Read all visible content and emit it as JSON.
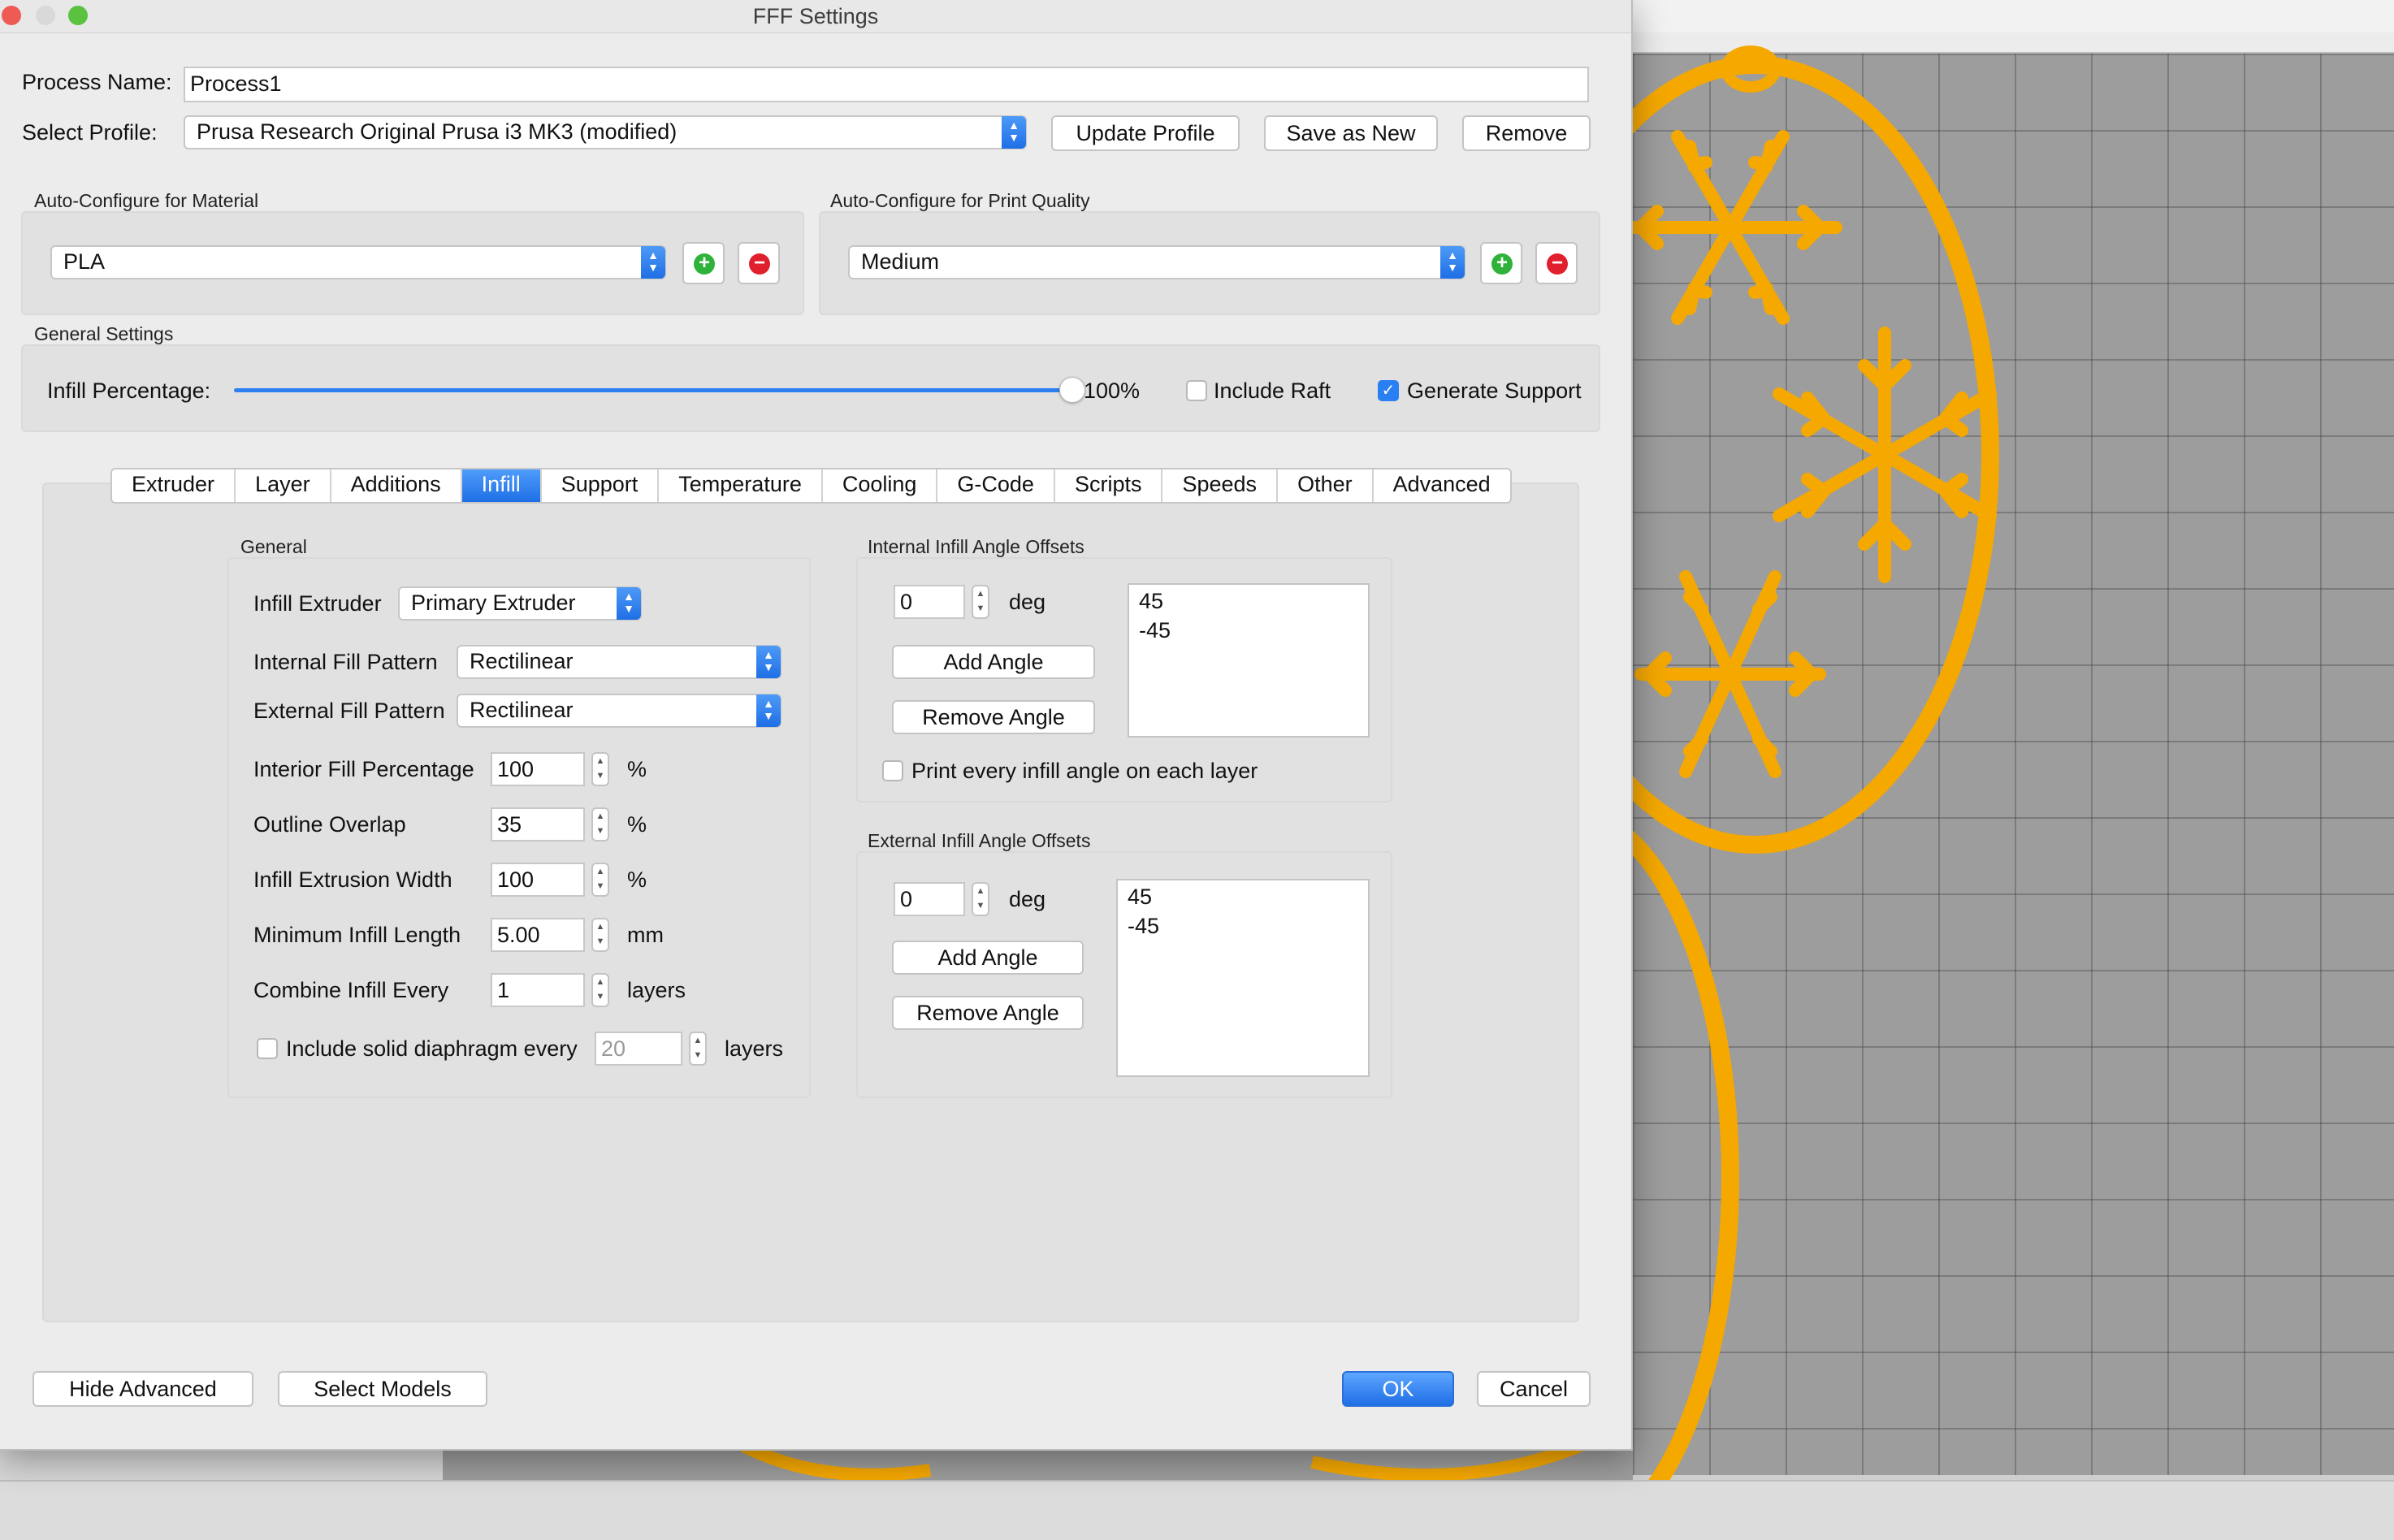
{
  "window": {
    "title": "FFF Settings"
  },
  "process": {
    "name_label": "Process Name:",
    "name_value": "Process1"
  },
  "profile": {
    "label": "Select Profile:",
    "selected": "Prusa Research Original Prusa i3 MK3 (modified)",
    "update_label": "Update Profile",
    "save_as_new_label": "Save as New",
    "remove_label": "Remove"
  },
  "material": {
    "heading": "Auto-Configure for Material",
    "selected": "PLA"
  },
  "quality": {
    "heading": "Auto-Configure for Print Quality",
    "selected": "Medium"
  },
  "general_settings": {
    "heading": "General Settings",
    "infill_label": "Infill Percentage:",
    "infill_value_text": "100%",
    "infill_fraction": 1.0,
    "include_raft_label": "Include Raft",
    "include_raft_checked": false,
    "generate_support_label": "Generate Support",
    "generate_support_checked": true
  },
  "tabs": [
    {
      "label": "Extruder",
      "active": false
    },
    {
      "label": "Layer",
      "active": false
    },
    {
      "label": "Additions",
      "active": false
    },
    {
      "label": "Infill",
      "active": true
    },
    {
      "label": "Support",
      "active": false
    },
    {
      "label": "Temperature",
      "active": false
    },
    {
      "label": "Cooling",
      "active": false
    },
    {
      "label": "G-Code",
      "active": false
    },
    {
      "label": "Scripts",
      "active": false
    },
    {
      "label": "Speeds",
      "active": false
    },
    {
      "label": "Other",
      "active": false
    },
    {
      "label": "Advanced",
      "active": false
    }
  ],
  "infill_general": {
    "heading": "General",
    "extruder_label": "Infill Extruder",
    "extruder_value": "Primary Extruder",
    "internal_pattern_label": "Internal Fill Pattern",
    "internal_pattern_value": "Rectilinear",
    "external_pattern_label": "External Fill Pattern",
    "external_pattern_value": "Rectilinear",
    "interior_pct_label": "Interior Fill Percentage",
    "interior_pct_value": "100",
    "interior_pct_unit": "%",
    "outline_overlap_label": "Outline Overlap",
    "outline_overlap_value": "35",
    "outline_overlap_unit": "%",
    "extrusion_width_label": "Infill Extrusion Width",
    "extrusion_width_value": "100",
    "extrusion_width_unit": "%",
    "min_length_label": "Minimum Infill Length",
    "min_length_value": "5.00",
    "min_length_unit": "mm",
    "combine_label": "Combine Infill Every",
    "combine_value": "1",
    "combine_unit": "layers",
    "diaphragm_label": "Include solid diaphragm every",
    "diaphragm_value": "20",
    "diaphragm_unit": "layers",
    "diaphragm_checked": false
  },
  "internal_offsets": {
    "heading": "Internal Infill Angle Offsets",
    "angle_value": "0",
    "unit": "deg",
    "add_label": "Add Angle",
    "remove_label": "Remove Angle",
    "angles": [
      "45",
      "-45"
    ],
    "every_layer_label": "Print every infill angle on each layer",
    "every_layer_checked": false
  },
  "external_offsets": {
    "heading": "External Infill Angle Offsets",
    "angle_value": "0",
    "unit": "deg",
    "add_label": "Add Angle",
    "remove_label": "Remove Angle",
    "angles": [
      "45",
      "-45"
    ]
  },
  "footer": {
    "hide_advanced_label": "Hide Advanced",
    "select_models_label": "Select Models",
    "ok_label": "OK",
    "cancel_label": "Cancel"
  },
  "colors": {
    "accent": "#1f6fe6",
    "model_orange": "#f5a800",
    "bed_grey": "#9d9d9d"
  }
}
